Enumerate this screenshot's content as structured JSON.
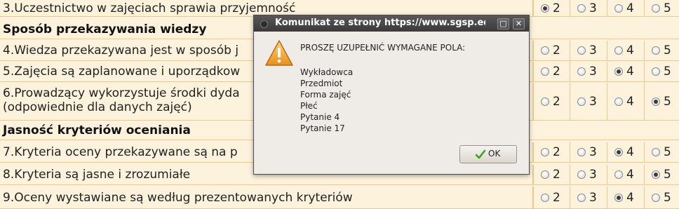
{
  "survey": {
    "rows": [
      {
        "kind": "question",
        "text": "3.Uczestnictwo w zajęciach sprawia przyjemność",
        "selected": "2"
      },
      {
        "kind": "section",
        "text": "Sposób przekazywania wiedzy"
      },
      {
        "kind": "question",
        "text": "4.Wiedza przekazywana jest w sposób j",
        "selected": null
      },
      {
        "kind": "question",
        "text": "5.Zajęcia są zaplanowane i uporządkow",
        "selected": "4"
      },
      {
        "kind": "question",
        "text": "6.Prowadzący wykorzystuje środki dyda",
        "text2": "(odpowiednie dla danych zajęć)",
        "selected": "5"
      },
      {
        "kind": "section",
        "text": "Jasność kryteriów oceniania"
      },
      {
        "kind": "question",
        "text": "7.Kryteria oceny przekazywane są na p",
        "selected": "4"
      },
      {
        "kind": "question",
        "text": "8.Kryteria są jasne i zrozumiałe",
        "selected": "5"
      },
      {
        "kind": "question",
        "text": "9.Oceny wystawiane są według prezentowanych kryteriów",
        "selected": "4"
      }
    ],
    "options": [
      "2",
      "3",
      "4",
      "5"
    ]
  },
  "dialog": {
    "title": "Komunikat ze strony https://www.sgsp.ed",
    "heading": "PROSZĘ UZUPEŁNIĆ WYMAGANE POLA:",
    "missing_fields": [
      "Wykładowca",
      "Przedmiot",
      "Forma zajęć",
      "Płeć",
      "Pytanie 4",
      "Pytanie 17"
    ],
    "ok_label": "OK",
    "icons": {
      "title": "window-menu-icon",
      "warning": "warning-icon",
      "maximize": "maximize-icon",
      "close": "close-icon",
      "ok": "checkmark-icon"
    }
  },
  "colors": {
    "background": "#fdf3dc",
    "cell_border": "#e8c98a",
    "titlebar": "#4a4a4a",
    "dialog_bg": "#efebe7",
    "warning": "#f0a020"
  }
}
